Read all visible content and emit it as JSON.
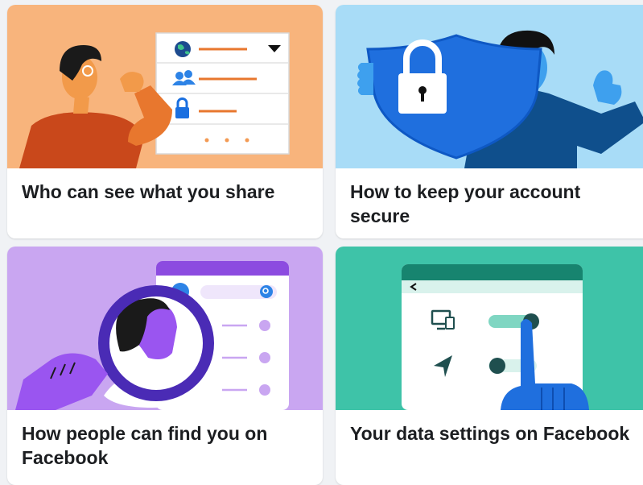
{
  "cards": [
    {
      "title": "Who can see what you share",
      "illustration": "privacy-audience-illustration",
      "background": "#f8b47c"
    },
    {
      "title": "How to keep your account secure",
      "illustration": "security-shield-illustration",
      "background": "#a8dcf7"
    },
    {
      "title": "How people can find you on Facebook",
      "illustration": "magnifier-search-illustration",
      "background": "#c9a6f1"
    },
    {
      "title": "Your data settings on Facebook",
      "illustration": "data-settings-illustration",
      "background": "#3ec3a8"
    }
  ]
}
